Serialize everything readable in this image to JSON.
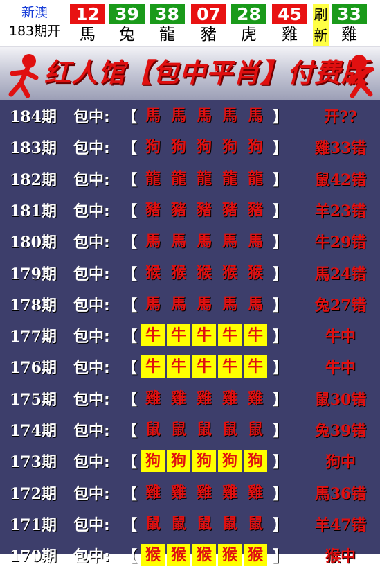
{
  "header": {
    "brand_line1": "新澳",
    "brand_line2": "183期开",
    "balls": [
      {
        "number": "12",
        "zodiac": "馬",
        "color": "red"
      },
      {
        "number": "39",
        "zodiac": "兔",
        "color": "green"
      },
      {
        "number": "38",
        "zodiac": "龍",
        "color": "green"
      },
      {
        "number": "07",
        "zodiac": "豬",
        "color": "red"
      },
      {
        "number": "28",
        "zodiac": "虎",
        "color": "green"
      },
      {
        "number": "45",
        "zodiac": "雞",
        "color": "red"
      }
    ],
    "refresh_label": "刷新",
    "special": {
      "number": "33",
      "zodiac": "雞",
      "color": "green"
    }
  },
  "banner": {
    "title": "红人馆【包中平肖】付费版"
  },
  "rows_label": "包中:",
  "rows": [
    {
      "period": "184期",
      "zodiac": "馬",
      "highlight": false,
      "result": "开??"
    },
    {
      "period": "183期",
      "zodiac": "狗",
      "highlight": false,
      "result": "雞33错"
    },
    {
      "period": "182期",
      "zodiac": "龍",
      "highlight": false,
      "result": "鼠42错"
    },
    {
      "period": "181期",
      "zodiac": "豬",
      "highlight": false,
      "result": "羊23错"
    },
    {
      "period": "180期",
      "zodiac": "馬",
      "highlight": false,
      "result": "牛29错"
    },
    {
      "period": "179期",
      "zodiac": "猴",
      "highlight": false,
      "result": "馬24错"
    },
    {
      "period": "178期",
      "zodiac": "馬",
      "highlight": false,
      "result": "兔27错"
    },
    {
      "period": "177期",
      "zodiac": "牛",
      "highlight": true,
      "result": "牛中"
    },
    {
      "period": "176期",
      "zodiac": "牛",
      "highlight": true,
      "result": "牛中"
    },
    {
      "period": "175期",
      "zodiac": "雞",
      "highlight": false,
      "result": "鼠30错"
    },
    {
      "period": "174期",
      "zodiac": "鼠",
      "highlight": false,
      "result": "兔39错"
    },
    {
      "period": "173期",
      "zodiac": "狗",
      "highlight": true,
      "result": "狗中"
    },
    {
      "period": "172期",
      "zodiac": "雞",
      "highlight": false,
      "result": "馬36错"
    },
    {
      "period": "171期",
      "zodiac": "鼠",
      "highlight": false,
      "result": "羊47错"
    },
    {
      "period": "170期",
      "zodiac": "猴",
      "highlight": true,
      "result": "猴中"
    }
  ],
  "colors": {
    "red": "#e81212",
    "green": "#1a9a1a",
    "list_bg": "#3d3e6b",
    "highlight": "#ffff00"
  }
}
